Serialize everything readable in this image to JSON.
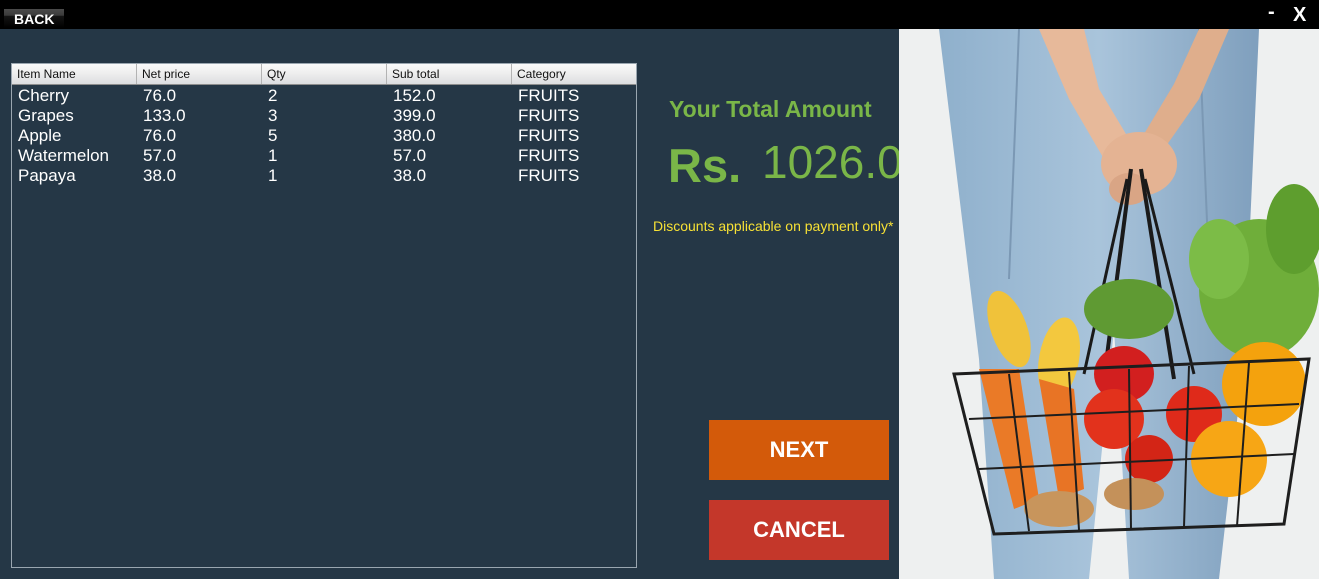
{
  "titlebar": {
    "back_label": "BACK",
    "minimize_label": "-",
    "close_label": "X"
  },
  "table": {
    "columns": [
      "Item Name",
      "Net price",
      "Qty",
      "Sub total",
      "Category"
    ],
    "rows": [
      [
        "Cherry",
        "76.0",
        "2",
        "152.0",
        "FRUITS"
      ],
      [
        "Grapes",
        "133.0",
        "3",
        "399.0",
        "FRUITS"
      ],
      [
        "Apple",
        "76.0",
        "5",
        "380.0",
        "FRUITS"
      ],
      [
        "Watermelon",
        "57.0",
        "1",
        "57.0",
        "FRUITS"
      ],
      [
        "Papaya",
        "38.0",
        "1",
        "38.0",
        "FRUITS"
      ]
    ]
  },
  "total": {
    "title": "Your Total Amount",
    "currency": "Rs.",
    "amount": "1026.0",
    "discount_note": "Discounts applicable on payment only*"
  },
  "actions": {
    "next_label": "NEXT",
    "cancel_label": "CANCEL"
  },
  "colors": {
    "background": "#253746",
    "accent_green": "#7ab648",
    "note_yellow": "#f7e135",
    "next_orange": "#d35a0a",
    "cancel_red": "#c4372a"
  },
  "image": {
    "icon": "vegetable-basket-photo"
  }
}
